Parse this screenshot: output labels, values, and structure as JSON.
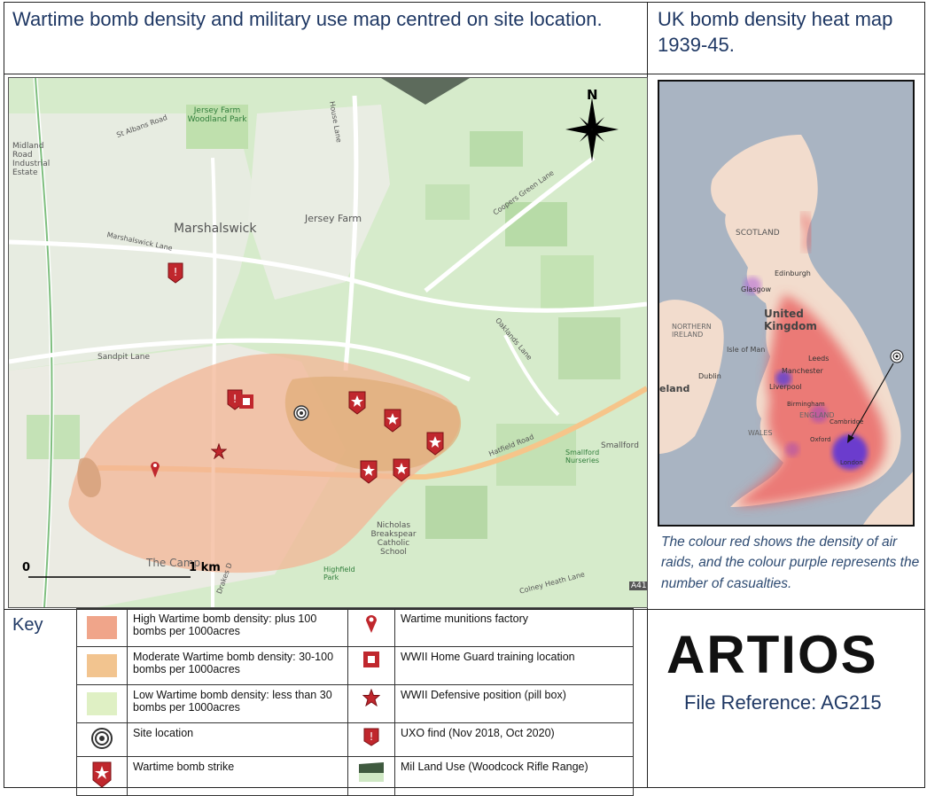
{
  "titles": {
    "main": "Wartime bomb density and military use map centred on site location.",
    "heat": "UK bomb density heat map 1939-45."
  },
  "map": {
    "north": "N",
    "scale_start": "0",
    "scale_end": "1 km",
    "places": {
      "marshalswick": "Marshalswick",
      "jersey_farm": "Jersey Farm",
      "jersey_farm_park": "Jersey Farm Woodland Park",
      "industrial": "Midland Road Industrial Estate",
      "sandpit_lane": "Sandpit Lane",
      "marshalswick_lane": "Marshalswick Lane",
      "st_albans_road": "St Albans Road",
      "house_lane": "House Lane",
      "coopers_green": "Coopers Green Lane",
      "oaklands_lane": "Oaklands Lane",
      "hatfield_road": "Hatfield Road",
      "smallford": "Smallford Nurseries",
      "smallford2": "Smallford",
      "nicholas": "Nicholas Breakspear Catholic School",
      "highfield": "Highfield Park",
      "the_camp": "The Camp",
      "colney": "Colney Heath Lane",
      "a414": "A41",
      "drakes": "Drakes D"
    }
  },
  "heatmap": {
    "labels": {
      "scotland": "SCOTLAND",
      "edinburgh": "Edinburgh",
      "glasgow": "Glasgow",
      "uk": "United Kingdom",
      "ni": "NORTHERN IRELAND",
      "isle_of_man": "Isle of Man",
      "dublin": "Dublin",
      "ireland": "eland",
      "leeds": "Leeds",
      "manchester": "Manchester",
      "liverpool": "Liverpool",
      "england": "ENGLAND",
      "cambridge": "Cambridge",
      "wales": "WALES",
      "oxford": "Oxford",
      "london": "London",
      "birmingham": "Birmingham"
    }
  },
  "caption": "The colour red shows the density of air raids, and the colour purple represents the number of casualties.",
  "key": {
    "title": "Key",
    "items": [
      {
        "label": "High Wartime bomb density: plus 100 bombs per 1000acres",
        "color": "#f0a58a"
      },
      {
        "label": "Moderate Wartime bomb density: 30-100 bombs per 1000acres",
        "color": "#f2c48f"
      },
      {
        "label": "Low Wartime bomb density: less than 30 bombs per 1000acres",
        "color": "#dff0c4"
      },
      {
        "label": "Site location",
        "icon": "target-icon"
      },
      {
        "label": "Wartime bomb strike",
        "icon": "bomb-strike-icon"
      },
      {
        "label": "Wartime munitions factory",
        "icon": "map-pin-icon"
      },
      {
        "label": "WWII Home Guard training location",
        "icon": "square-icon"
      },
      {
        "label": "WWII Defensive position (pill box)",
        "icon": "star-icon"
      },
      {
        "label": "UXO find (Nov 2018, Oct 2020)",
        "icon": "warning-icon"
      },
      {
        "label": "Mil Land Use (Woodcock Rifle Range)",
        "icon": "land-use-icon"
      }
    ]
  },
  "brand": {
    "logo": "ARTIOS",
    "reference": "File Reference: AG215"
  },
  "colors": {
    "title": "#1f3864",
    "bomb_red": "#c0272d",
    "high_density": "#f0a58a",
    "moderate_density": "#e3b27a",
    "map_green": "#cfe8c4"
  }
}
